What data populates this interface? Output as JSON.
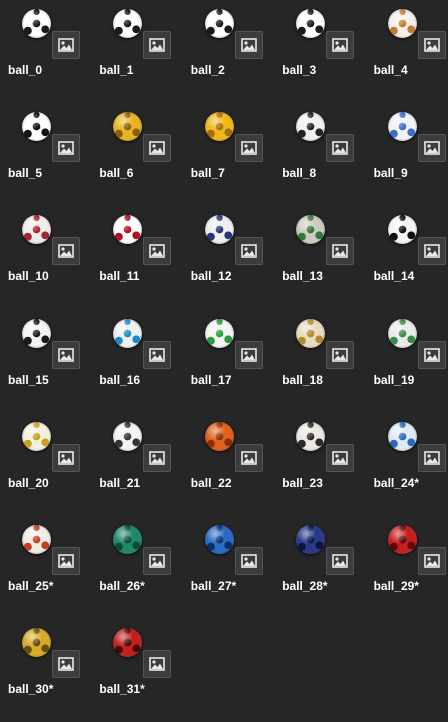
{
  "assets": [
    {
      "label": "ball_0",
      "icon": "soccer-ball-classic",
      "colors": [
        "#ffffff",
        "#1a1a1a"
      ]
    },
    {
      "label": "ball_1",
      "icon": "soccer-ball-classic",
      "colors": [
        "#ffffff",
        "#1a1a1a"
      ]
    },
    {
      "label": "ball_2",
      "icon": "soccer-ball-classic",
      "colors": [
        "#ffffff",
        "#1a1a1a"
      ]
    },
    {
      "label": "ball_3",
      "icon": "soccer-ball-classic",
      "colors": [
        "#ffffff",
        "#1a1a1a"
      ]
    },
    {
      "label": "ball_4",
      "icon": "soccer-ball-telstar",
      "colors": [
        "#f2f0ea",
        "#c47a2c"
      ]
    },
    {
      "label": "ball_5",
      "icon": "soccer-ball-classic",
      "colors": [
        "#ffffff",
        "#111111"
      ]
    },
    {
      "label": "ball_6",
      "icon": "soccer-ball-gold",
      "colors": [
        "#e8b520",
        "#8a5f08"
      ]
    },
    {
      "label": "ball_7",
      "icon": "soccer-ball-gold",
      "colors": [
        "#f0b818",
        "#a86e06"
      ]
    },
    {
      "label": "ball_8",
      "icon": "soccer-ball-white",
      "colors": [
        "#f0f0f0",
        "#222222"
      ]
    },
    {
      "label": "ball_9",
      "icon": "soccer-ball-white",
      "colors": [
        "#f2f2f5",
        "#3a6ec8"
      ]
    },
    {
      "label": "ball_10",
      "icon": "soccer-ball-white",
      "colors": [
        "#f0eceb",
        "#a8242c"
      ]
    },
    {
      "label": "ball_11",
      "icon": "soccer-ball-red",
      "colors": [
        "#ffffff",
        "#b2101c"
      ]
    },
    {
      "label": "ball_12",
      "icon": "soccer-ball-white",
      "colors": [
        "#eeeeee",
        "#24357a"
      ]
    },
    {
      "label": "ball_13",
      "icon": "soccer-ball-grey",
      "colors": [
        "#cfcac0",
        "#2d7a3a"
      ]
    },
    {
      "label": "ball_14",
      "icon": "soccer-ball-white",
      "colors": [
        "#f4f4f4",
        "#111111"
      ]
    },
    {
      "label": "ball_15",
      "icon": "soccer-ball-white",
      "colors": [
        "#f2f2f2",
        "#1a1a1a"
      ]
    },
    {
      "label": "ball_16",
      "icon": "soccer-ball-white",
      "colors": [
        "#f0f0f0",
        "#1c8ac8"
      ]
    },
    {
      "label": "ball_17",
      "icon": "soccer-ball-white",
      "colors": [
        "#f4f4f4",
        "#2a9a3a"
      ]
    },
    {
      "label": "ball_18",
      "icon": "soccer-ball-gold",
      "colors": [
        "#e8dcc0",
        "#b08a30"
      ]
    },
    {
      "label": "ball_19",
      "icon": "soccer-ball-white",
      "colors": [
        "#eaeaea",
        "#3a8a4a"
      ]
    },
    {
      "label": "ball_20",
      "icon": "soccer-ball-white",
      "colors": [
        "#f4f0e0",
        "#c8a020"
      ]
    },
    {
      "label": "ball_21",
      "icon": "soccer-ball-white",
      "colors": [
        "#f2f2f2",
        "#333333"
      ]
    },
    {
      "label": "ball_22",
      "icon": "soccer-ball-orange",
      "colors": [
        "#e0621c",
        "#8a2e08"
      ]
    },
    {
      "label": "ball_23",
      "icon": "soccer-ball-white",
      "colors": [
        "#ece8e0",
        "#2a2a2a"
      ]
    },
    {
      "label": "ball_24*",
      "icon": "soccer-ball-blue",
      "colors": [
        "#dceaf4",
        "#2a6ab8"
      ]
    },
    {
      "label": "ball_25*",
      "icon": "soccer-ball-white",
      "colors": [
        "#f0ece4",
        "#c83a24"
      ]
    },
    {
      "label": "ball_26*",
      "icon": "soccer-ball-green",
      "colors": [
        "#1f8a6a",
        "#0c4a38"
      ]
    },
    {
      "label": "ball_27*",
      "icon": "soccer-ball-blue",
      "colors": [
        "#2a6ac8",
        "#0e2e6a"
      ]
    },
    {
      "label": "ball_28*",
      "icon": "soccer-ball-navy",
      "colors": [
        "#2a3a8a",
        "#0c1440"
      ]
    },
    {
      "label": "ball_29*",
      "icon": "soccer-ball-red",
      "colors": [
        "#c81e1e",
        "#5a0808"
      ]
    },
    {
      "label": "ball_30*",
      "icon": "soccer-ball-gold",
      "colors": [
        "#d8aa28",
        "#6a4a0a"
      ]
    },
    {
      "label": "ball_31*",
      "icon": "soccer-ball-red",
      "colors": [
        "#c02020",
        "#4a0606"
      ]
    }
  ],
  "badge_icon": "image-icon"
}
